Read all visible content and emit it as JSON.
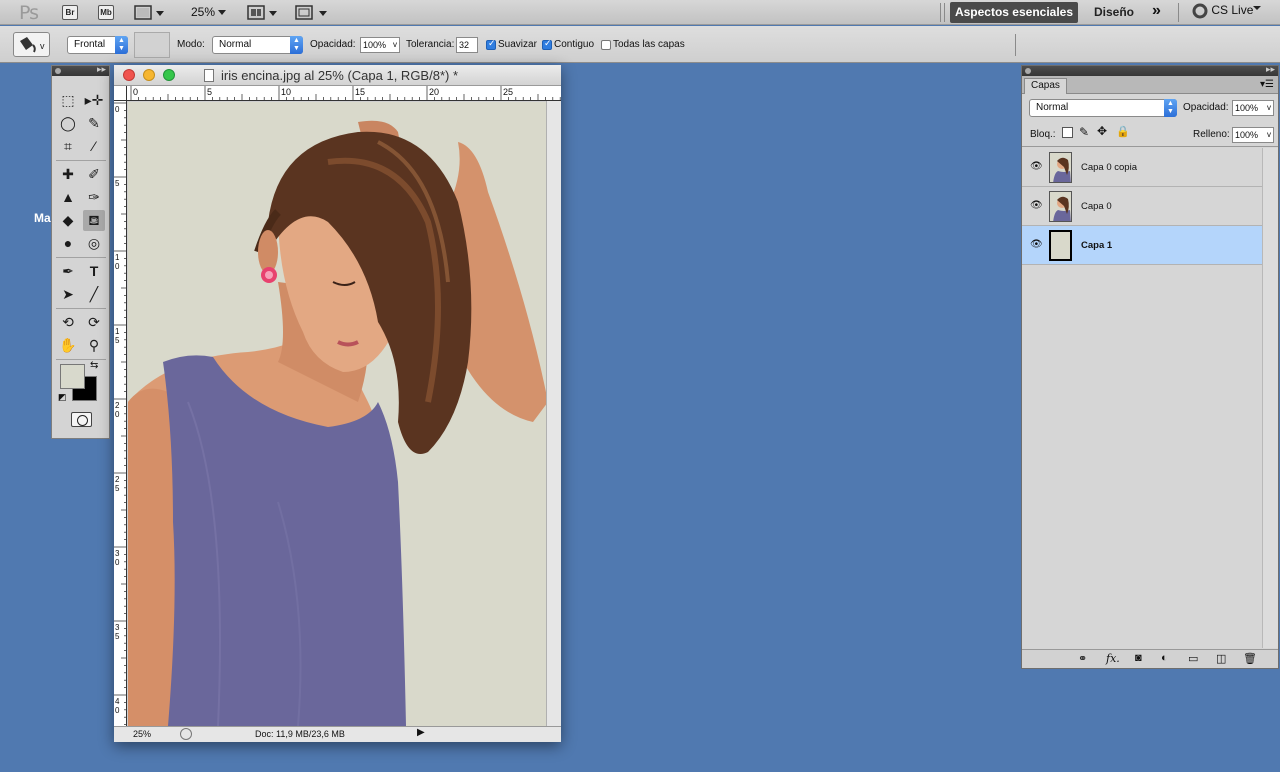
{
  "appbar": {
    "logo": "Ps",
    "bridge_label": "Br",
    "minibridge_label": "Mb",
    "zoom": "25%",
    "workspace_active": "Aspectos esenciales",
    "workspace_other": "Diseño",
    "more_workspaces": "»",
    "cslive": "CS Live"
  },
  "options": {
    "fill_source": "Frontal",
    "mode_label": "Modo:",
    "mode_value": "Normal",
    "opacity_label": "Opacidad:",
    "opacity_value": "100%",
    "tolerance_label": "Tolerancia:",
    "tolerance_value": "32",
    "antialias_label": "Suavizar",
    "antialias_checked": true,
    "contiguous_label": "Contiguo",
    "contiguous_checked": true,
    "all_layers_label": "Todas las capas",
    "all_layers_checked": false
  },
  "left_label": "Ma",
  "document": {
    "title": "iris encina.jpg al 25% (Capa 1, RGB/8*) *",
    "ruler_h": [
      "0",
      "5",
      "10",
      "15",
      "20",
      "25"
    ],
    "ruler_v": [
      "0",
      "5",
      "1\n0",
      "1\n5",
      "2\n0",
      "2\n5",
      "3\n0",
      "3\n5",
      "4\n0"
    ],
    "status_zoom": "25%",
    "status_info": "Doc: 11,9 MB/23,6 MB",
    "canvas_color": "#d9d9cb"
  },
  "colors": {
    "foreground": "#d8d9cc",
    "background": "#000000",
    "desktop": "#5079b0",
    "selection": "#b4d5fb"
  },
  "layers_panel": {
    "tab": "Capas",
    "blend_mode": "Normal",
    "opacity_label": "Opacidad:",
    "opacity_value": "100%",
    "lock_label": "Bloq.:",
    "fill_label": "Relleno:",
    "fill_value": "100%",
    "layers": [
      {
        "name": "Capa 0 copia",
        "visible": true,
        "selected": false
      },
      {
        "name": "Capa 0",
        "visible": true,
        "selected": false
      },
      {
        "name": "Capa 1",
        "visible": true,
        "selected": true
      }
    ]
  }
}
